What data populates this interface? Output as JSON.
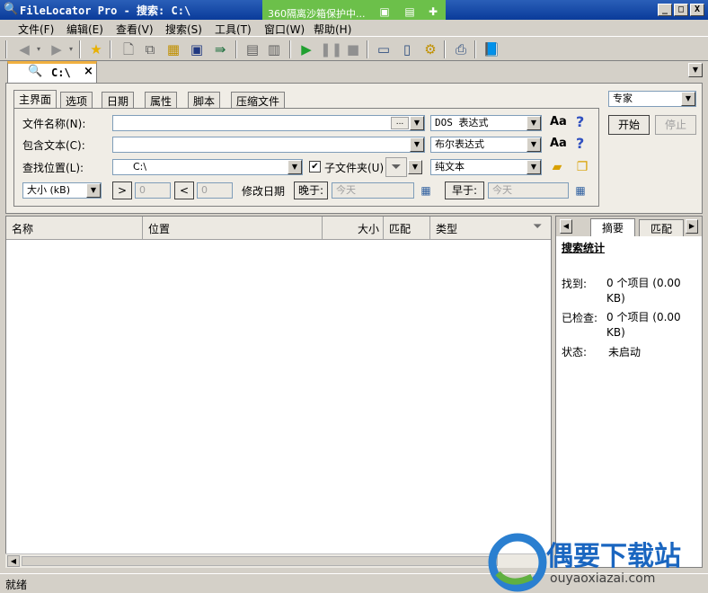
{
  "window": {
    "title": "FileLocator Pro - 搜索: C:\\",
    "btn_min": "_",
    "btn_max": "□",
    "btn_close": "X"
  },
  "banner360": {
    "text": "360隔离沙箱保护中..."
  },
  "menu": [
    "文件(F)",
    "编辑(E)",
    "查看(V)",
    "搜索(S)",
    "工具(T)",
    "窗口(W)",
    "帮助(H)"
  ],
  "search_tab": {
    "label": "C:\\",
    "close": "×"
  },
  "criteria": {
    "tabs": [
      "主界面",
      "选项",
      "日期",
      "属性",
      "脚本",
      "压缩文件"
    ],
    "file_name_label": "文件名称(N):",
    "file_name_value": "",
    "file_name_browse": "...",
    "file_name_mode": "DOS 表达式",
    "contain_text_label": "包含文本(C):",
    "contain_text_value": "",
    "contain_text_mode": "布尔表达式",
    "look_in_label": "查找位置(L):",
    "look_in_value": "C:\\",
    "subfolders_label": "子文件夹(U)",
    "subfolders_checked": true,
    "content_type": "纯文本",
    "size_mode": "大小 (kB)",
    "size_gt": ">",
    "size_gt_value": "0",
    "size_lt": "<",
    "size_lt_value": "0",
    "modified_label": "修改日期",
    "after_label": "晚于:",
    "after_value": "今天",
    "before_label": "早于:",
    "before_value": "今天",
    "case_label": "Aa",
    "help_label": "?"
  },
  "side": {
    "mode": "专家",
    "start": "开始",
    "stop": "停止"
  },
  "results": {
    "columns": [
      "名称",
      "位置",
      "大小",
      "匹配",
      "类型"
    ]
  },
  "summary": {
    "tabs": [
      "摘要",
      "匹配"
    ],
    "heading": "搜索统计",
    "rows": [
      {
        "label": "找到:",
        "value": "0 个项目 (0.00 KB)"
      },
      {
        "label": "已检查:",
        "value": "0 个项目 (0.00 KB)"
      },
      {
        "label": "状态:",
        "value": "未启动"
      }
    ]
  },
  "status": {
    "text": "就绪"
  },
  "watermark": {
    "brand": "偶要下载站",
    "url": "ouyaoxiazai.com"
  },
  "colors": {
    "titlebar": "#0a3b9a",
    "banner": "#6cc04a",
    "accent_tab": "#f0b040"
  }
}
